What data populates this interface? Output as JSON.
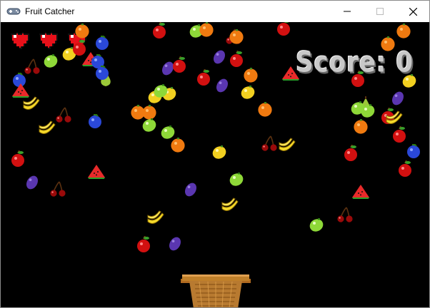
{
  "window": {
    "title": "Fruit Catcher",
    "icon": "gamepad-icon",
    "controls": [
      "minimize-icon",
      "maximize-icon",
      "close-icon"
    ]
  },
  "hud": {
    "score_label": "Score: 0",
    "lives": 3,
    "life_icon": "heart-icon"
  },
  "colors": {
    "background": "#000000",
    "heart": "#e8101a",
    "score": "#c8c8c8",
    "basket": "#c0802a"
  },
  "fruit_types": [
    "apple",
    "orange",
    "lemon",
    "lime",
    "banana",
    "cherries",
    "plum",
    "blueberry",
    "watermelon",
    "pear"
  ],
  "player": {
    "object": "basket"
  }
}
